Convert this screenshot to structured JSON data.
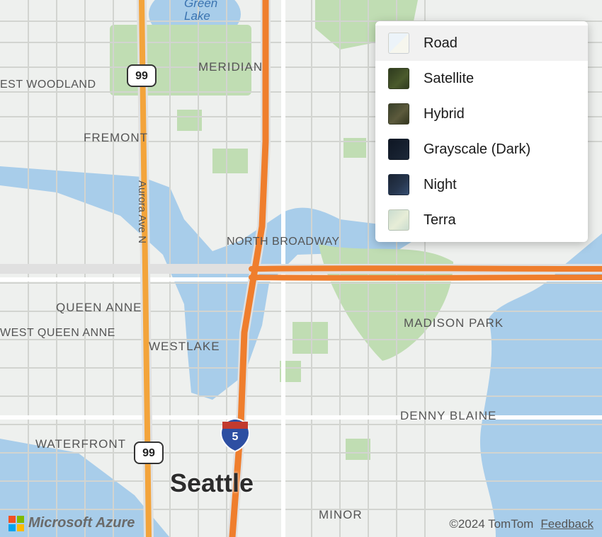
{
  "map": {
    "city_label": "Seattle",
    "water": {
      "green_lake": "Green\nLake"
    },
    "neighborhoods": {
      "meridian": "MERIDIAN",
      "est_woodland": "EST WOODLAND",
      "fremont": "FREMONT",
      "queen_anne": "QUEEN ANNE",
      "west_queen_anne": "WEST QUEEN ANNE",
      "westlake": "WESTLAKE",
      "north_broadway": "NORTH BROADWAY",
      "madison_park": "MADISON PARK",
      "denny_blaine": "DENNY BLAINE",
      "waterfront": "WATERFRONT",
      "minor": "MINOR"
    },
    "streets": {
      "aurora": "Aurora Ave N"
    },
    "routes": {
      "sr99_a": "99",
      "sr99_b": "99",
      "i5": "5"
    }
  },
  "style_picker": {
    "items": [
      {
        "id": "road",
        "label": "Road",
        "selected": true
      },
      {
        "id": "satellite",
        "label": "Satellite",
        "selected": false
      },
      {
        "id": "hybrid",
        "label": "Hybrid",
        "selected": false
      },
      {
        "id": "grayscale",
        "label": "Grayscale (Dark)",
        "selected": false
      },
      {
        "id": "night",
        "label": "Night",
        "selected": false
      },
      {
        "id": "terra",
        "label": "Terra",
        "selected": false
      }
    ]
  },
  "attribution": {
    "brand": "Microsoft Azure",
    "copyright": "©2024 TomTom",
    "feedback": "Feedback"
  }
}
